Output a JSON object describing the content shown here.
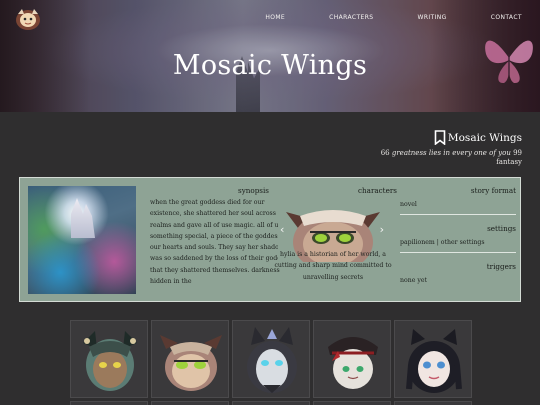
{
  "nav": {
    "items": [
      "HOME",
      "CHARACTERS",
      "WRITING",
      "CONTACT"
    ]
  },
  "hero": {
    "title": "Mosaic Wings"
  },
  "project": {
    "title": "Mosaic Wings",
    "tagline_open": "66",
    "tagline": "greatness lies in every one of you",
    "tagline_close": "99",
    "genre": "fantasy"
  },
  "synopsis": {
    "label": "synopsis",
    "text": "when the great goddess died for our existence, she shattered her soul across the realms and gave all of use magic. all of us something special, a piece of the goddess in our hearts and souls. They say her shadow was so saddened by the loss of their goddess, that they shattered themselves. darkness hidden in the"
  },
  "characters": {
    "label": "characters",
    "bio": "hylia is a historian of her world, a cutting and sharp mind committed to unravelling secrets",
    "prev": "‹",
    "next": "›"
  },
  "meta": {
    "story_format": {
      "label": "story format",
      "value": "novel"
    },
    "settings": {
      "label": "settings",
      "value": "papilionem | other settings"
    },
    "triggers": {
      "label": "triggers",
      "value": "none yet"
    }
  },
  "colors": {
    "panel": "#8ea395",
    "background": "#2f2e2f",
    "tile": "#3a393b"
  },
  "icons": [
    "logo-icon",
    "bookmark-icon",
    "butterfly-icon",
    "chevron-left-icon",
    "chevron-right-icon"
  ]
}
